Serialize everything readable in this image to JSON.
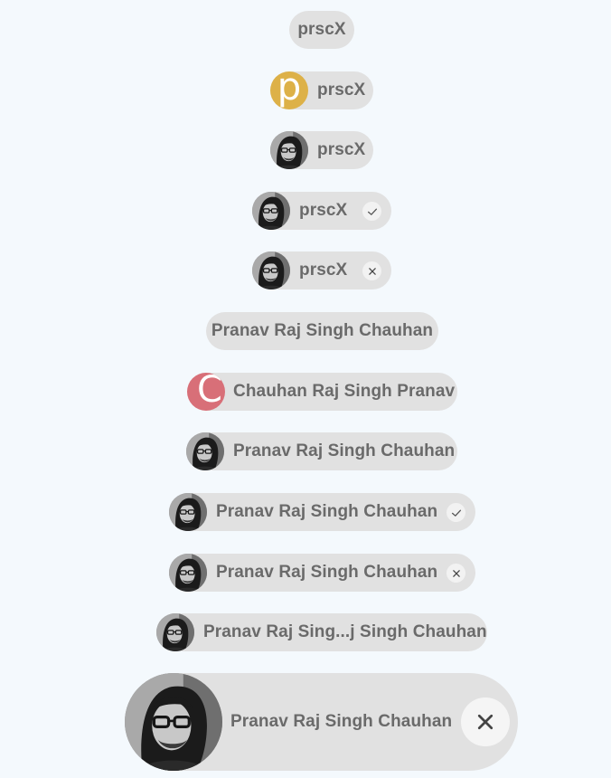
{
  "colors": {
    "background": "#f4f9fd",
    "chip": "#e1e1e1",
    "text": "#6a6a6a",
    "avatar_p": "#ddb148",
    "avatar_c": "#d86f78",
    "action_bg": "#f2f2f2"
  },
  "chips": [
    {
      "label": "prscX",
      "avatar": "none",
      "action": "none"
    },
    {
      "label": "prscX",
      "avatar": "letter",
      "avatar_letter": "p",
      "action": "none"
    },
    {
      "label": "prscX",
      "avatar": "photo",
      "action": "none"
    },
    {
      "label": "prscX",
      "avatar": "photo",
      "action": "check-icon"
    },
    {
      "label": "prscX",
      "avatar": "photo",
      "action": "close-icon"
    },
    {
      "label": "Pranav Raj Singh Chauhan",
      "avatar": "none",
      "action": "none"
    },
    {
      "label": "Chauhan Raj Singh Pranav",
      "avatar": "letter",
      "avatar_letter": "C",
      "action": "none"
    },
    {
      "label": "Pranav Raj Singh Chauhan",
      "avatar": "photo",
      "action": "none"
    },
    {
      "label": "Pranav Raj Singh Chauhan",
      "avatar": "photo",
      "action": "check-icon"
    },
    {
      "label": "Pranav Raj Singh Chauhan",
      "avatar": "photo",
      "action": "close-icon"
    },
    {
      "label": "Pranav Raj Sing...j Singh Chauhan",
      "avatar": "photo",
      "action": "none"
    },
    {
      "label": "Pranav Raj Singh Chauhan",
      "avatar": "photo",
      "action": "close-icon"
    }
  ]
}
